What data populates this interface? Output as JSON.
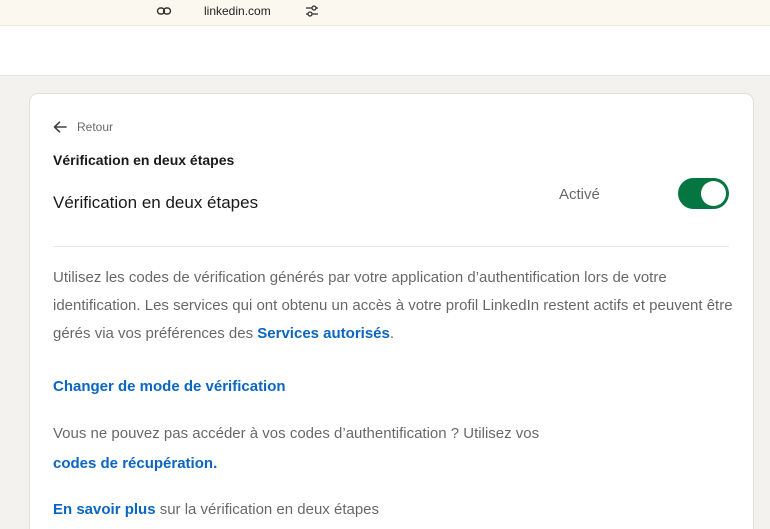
{
  "browser": {
    "domain": "linkedin.com",
    "link_icon": "link-icon",
    "tune_icon": "tune-icon"
  },
  "nav": {
    "back_label": "Retour",
    "back_icon": "arrow-left-icon"
  },
  "page": {
    "title": "Vérification en deux étapes"
  },
  "setting": {
    "label": "Vérification en deux étapes",
    "status": "Activé",
    "enabled": true,
    "toggle_color": "#057642"
  },
  "description": {
    "text": "Utilisez les codes de vérification générés par votre application d’authentification lors de votre identification. Les services qui ont obtenu un accès à votre profil LinkedIn restent actifs et peuvent être gérés via vos préférences des ",
    "link": "Services autorisés",
    "end": "."
  },
  "change_mode": {
    "label": "Changer de mode de vérification"
  },
  "recovery": {
    "text": "Vous ne pouvez pas accéder à vos codes d’authentification ? Utilisez vos",
    "link": "codes de récupération",
    "end": "."
  },
  "learn_more": {
    "link": "En savoir plus",
    "text": " sur la vérification en deux étapes"
  },
  "colors": {
    "link": "#0a66c2",
    "background": "#f4f2ee",
    "card": "#ffffff"
  }
}
